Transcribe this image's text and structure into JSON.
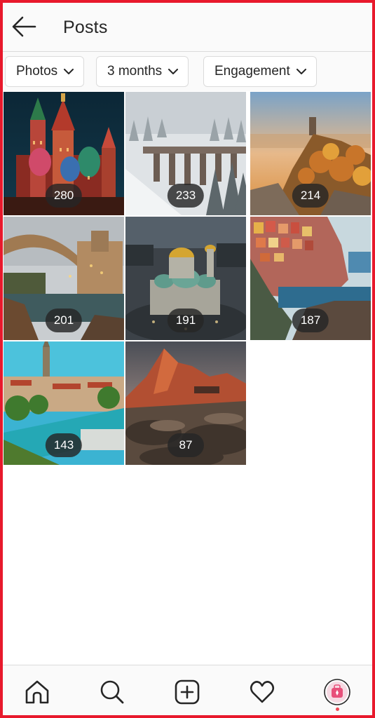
{
  "header": {
    "title": "Posts",
    "back_icon": "arrow-left-icon"
  },
  "filters": [
    {
      "label": "Photos",
      "icon": "chevron-down-icon"
    },
    {
      "label": "3 months",
      "icon": "chevron-down-icon"
    },
    {
      "label": "Engagement",
      "icon": "chevron-down-icon"
    }
  ],
  "posts": [
    {
      "subject": "St Basil's Cathedral at night",
      "count": "280"
    },
    {
      "subject": "Snowy forest with stone viaduct",
      "count": "233"
    },
    {
      "subject": "Autumn cliffside fortress",
      "count": "214"
    },
    {
      "subject": "Old stone arch bridge over river",
      "count": "201"
    },
    {
      "subject": "Golden-domed cathedral aerial",
      "count": "191"
    },
    {
      "subject": "Colorful cliffside village by the sea",
      "count": "187"
    },
    {
      "subject": "City cathedral spire and turquoise river",
      "count": "143"
    },
    {
      "subject": "Mountain peak at sunset over rocks",
      "count": "87"
    }
  ],
  "bottom_nav": [
    {
      "name": "home-icon"
    },
    {
      "name": "search-icon"
    },
    {
      "name": "add-post-icon"
    },
    {
      "name": "heart-icon"
    },
    {
      "name": "profile-avatar-icon"
    }
  ],
  "colors": {
    "accent_frame": "#e8192c",
    "badge_bg": "#262626",
    "notification_dot": "#ed4956"
  }
}
